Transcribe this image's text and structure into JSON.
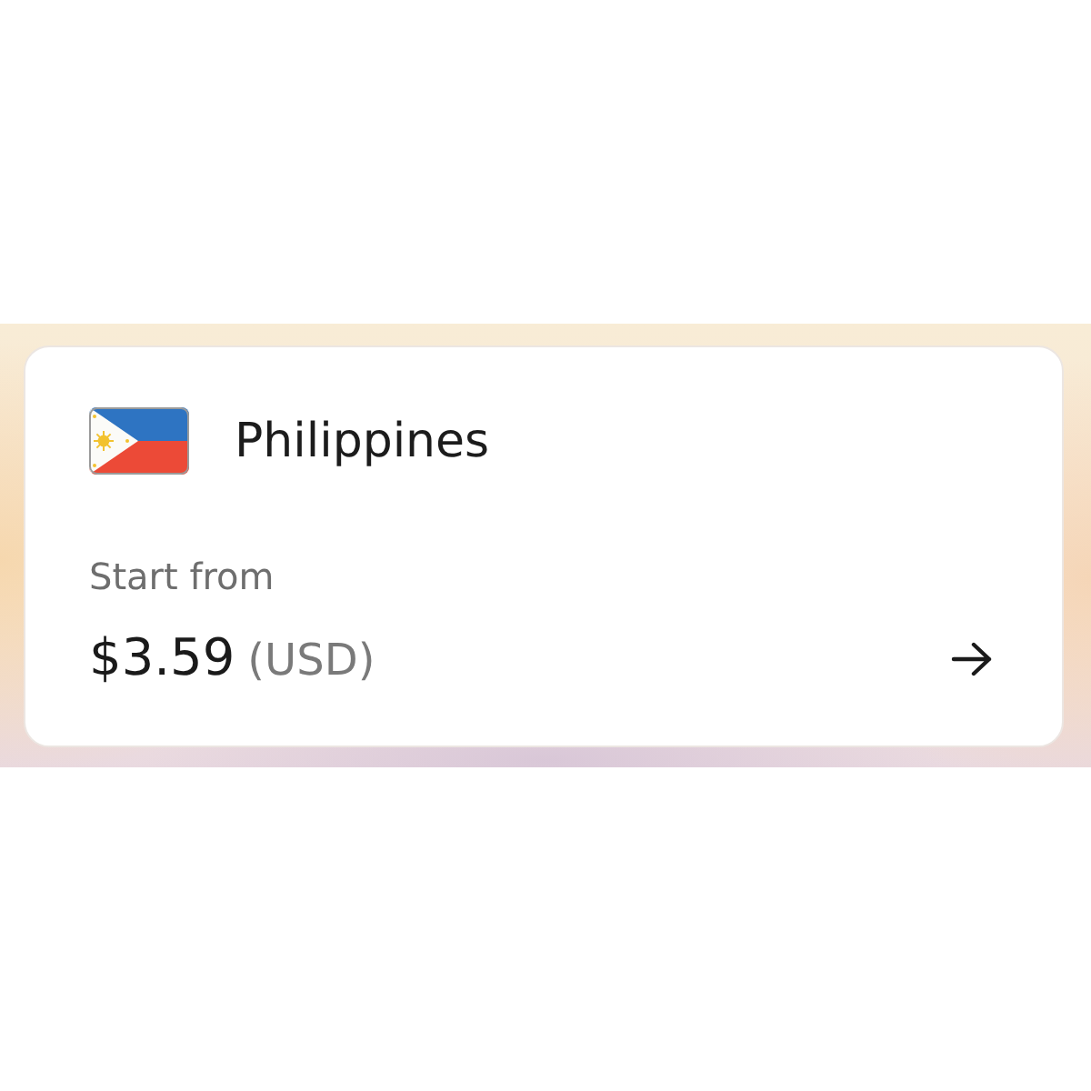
{
  "destination_card": {
    "country": "Philippines",
    "caption": "Start from",
    "price": "$3.59",
    "currency": "(USD)"
  }
}
